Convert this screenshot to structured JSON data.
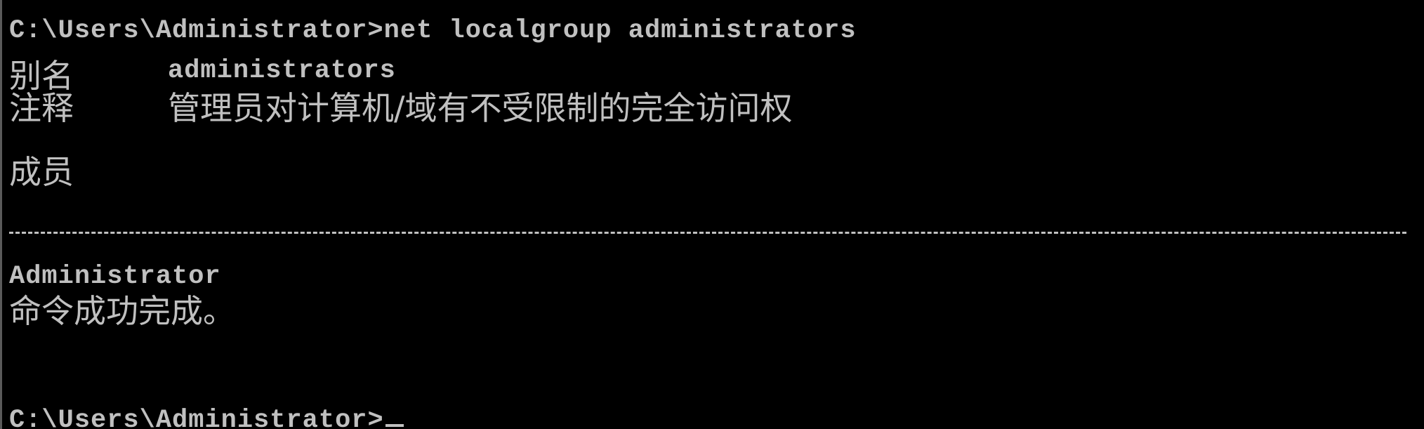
{
  "console": {
    "command_line": "C:\\Users\\Administrator>net localgroup administrators",
    "alias": {
      "label": "别名",
      "value": "administrators"
    },
    "comment": {
      "label": "注释",
      "value": "管理员对计算机/域有不受限制的完全访问权"
    },
    "members_label": "成员",
    "member": "Administrator",
    "success_message": "命令成功完成。",
    "prompt": "C:\\Users\\Administrator>"
  },
  "colors": {
    "background": "#000000",
    "foreground": "#C0C0C0"
  }
}
